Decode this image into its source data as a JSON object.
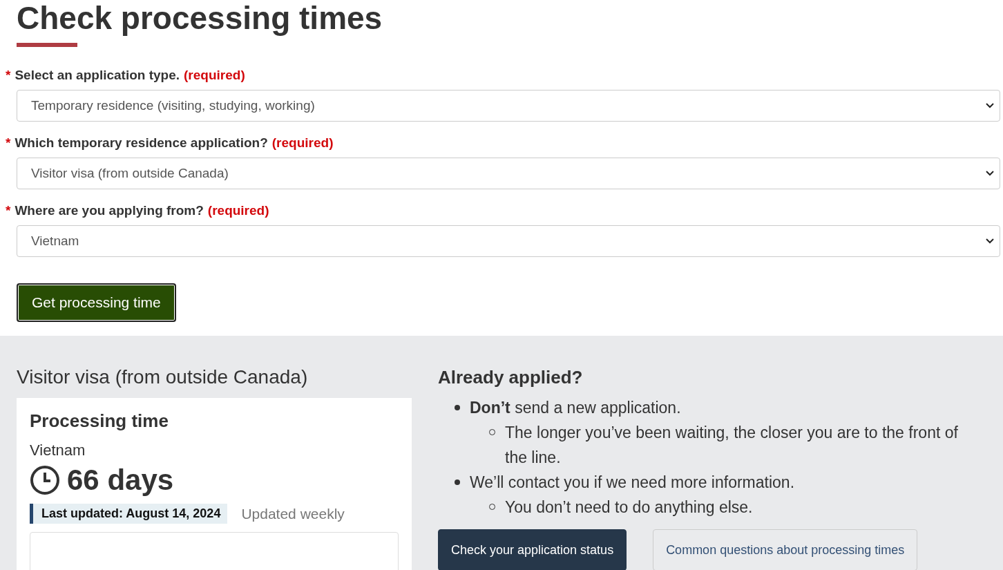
{
  "page_title": "Check processing times",
  "fields": [
    {
      "label": "Select an application type.",
      "required_mark": "*",
      "required_note": "(required)",
      "value": "Temporary residence (visiting, studying, working)"
    },
    {
      "label": "Which temporary residence application?",
      "required_mark": "*",
      "required_note": "(required)",
      "value": "Visitor visa (from outside Canada)"
    },
    {
      "label": "Where are you applying from?",
      "required_mark": "*",
      "required_note": "(required)",
      "value": "Vietnam"
    }
  ],
  "submit_button": "Get processing time",
  "result": {
    "title": "Visitor visa (from outside Canada)",
    "card": {
      "heading": "Processing time",
      "location": "Vietnam",
      "time": "66 days",
      "last_updated": "Last updated: August 14, 2024",
      "frequency": "Updated weekly"
    }
  },
  "already_applied": {
    "heading": "Already applied?",
    "items": [
      {
        "text": "**Don’t** send a new application.",
        "children": [
          {
            "text": "The longer you’ve been waiting, the closer you are to the front of the line."
          }
        ]
      },
      {
        "text": "We’ll contact you if we need more information.",
        "children": [
          {
            "text": "You don’t need to do anything else."
          }
        ]
      }
    ]
  },
  "buttons": [
    {
      "label": "Check your application status",
      "kind": "primary"
    },
    {
      "label": "Common questions about processing times",
      "kind": "secondary"
    }
  ]
}
